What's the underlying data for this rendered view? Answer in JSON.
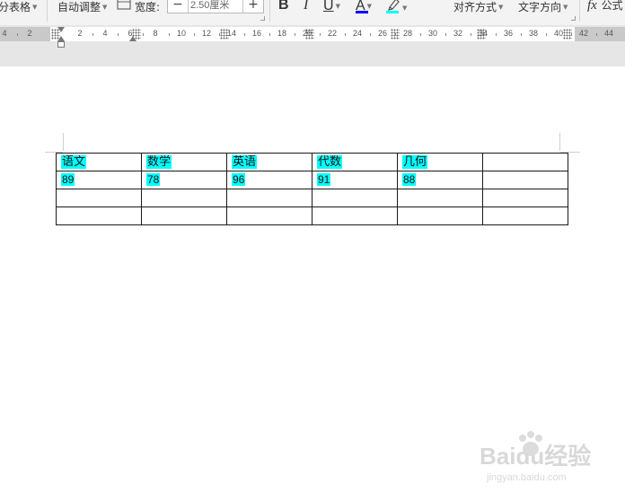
{
  "toolbar": {
    "split_table": "分表格",
    "auto_fit": "自动调整",
    "width_label": "宽度:",
    "width_value": "2.50厘米",
    "minus": "−",
    "plus": "+",
    "bold": "B",
    "italic": "I",
    "underline": "U",
    "font_color": "A",
    "align": "对齐方式",
    "text_direction": "文字方向",
    "formula_icon": "fx",
    "formula": "公式",
    "colors": {
      "font_color_bar": "#0000ff",
      "highlight_bar": "#00ffff"
    }
  },
  "ruler": {
    "numbers": [
      "4",
      "2",
      "2",
      "4",
      "6",
      "8",
      "10",
      "12",
      "14",
      "16",
      "18",
      "20",
      "22",
      "24",
      "26",
      "28",
      "30",
      "32",
      "34",
      "36",
      "38",
      "40",
      "42",
      "44"
    ]
  },
  "table": {
    "rows": [
      [
        "语文",
        "数学",
        "英语",
        "代数",
        "几何",
        ""
      ],
      [
        "89",
        "78",
        "96",
        "91",
        "88",
        ""
      ],
      [
        "",
        "",
        "",
        "",
        "",
        ""
      ],
      [
        "",
        "",
        "",
        "",
        "",
        ""
      ]
    ],
    "highlight_color": "#00ffff"
  },
  "watermark": {
    "brand": "Baidu经验",
    "url": "jingyan.baidu.com"
  }
}
